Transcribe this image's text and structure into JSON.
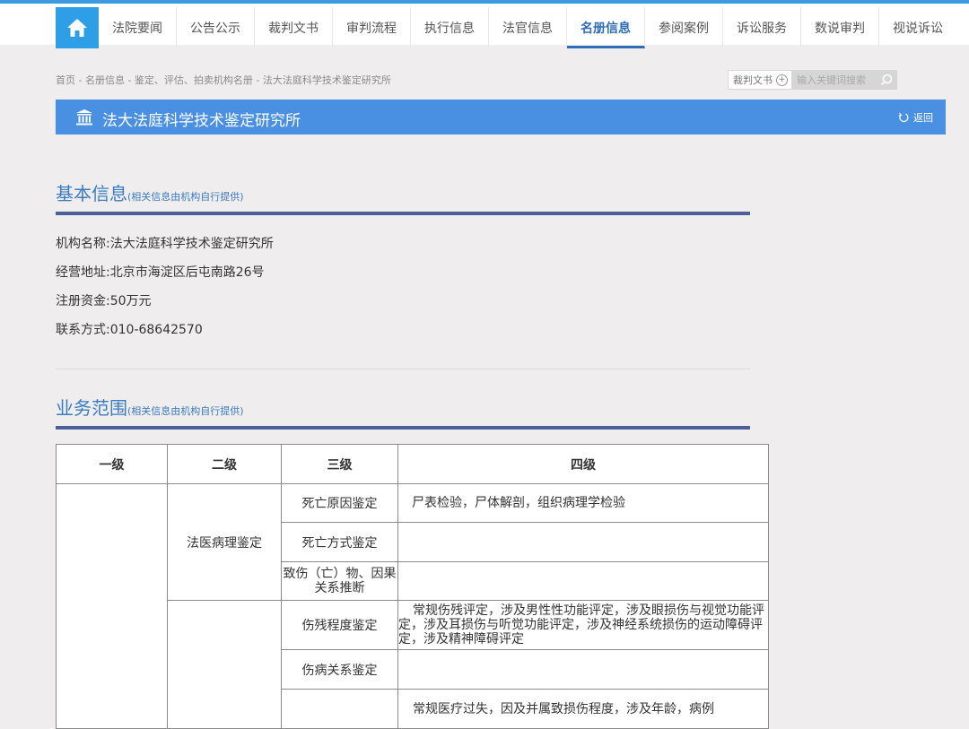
{
  "nav": {
    "home_icon": "home-icon",
    "items": [
      "法院要闻",
      "公告公示",
      "裁判文书",
      "审判流程",
      "执行信息",
      "法官信息",
      "名册信息",
      "参阅案例",
      "诉讼服务",
      "数说审判",
      "视说诉讼"
    ],
    "active_index": 6
  },
  "breadcrumb": "首页 - 名册信息 - 鉴定、评估、拍卖机构名册 - 法大法庭科学技术鉴定研究所",
  "search": {
    "scope": "裁判文书",
    "placeholder": "输入关键词搜索"
  },
  "titlebar": {
    "title": "法大法庭科学技术鉴定研究所",
    "back": "返回"
  },
  "basic": {
    "heading": "基本信息",
    "note": "(相关信息由机构自行提供)",
    "lines": [
      "机构名称:法大法庭科学技术鉴定研究所",
      "经营地址:北京市海淀区后屯南路26号",
      "注册资金:50万元",
      "联系方式:010-68642570"
    ]
  },
  "business": {
    "heading": "业务范围",
    "note": "(相关信息由机构自行提供)",
    "headers": [
      "一级",
      "二级",
      "三级",
      "四级"
    ],
    "rows": {
      "r1_l2": "法医病理鉴定",
      "r1_l3": "死亡原因鉴定",
      "r1_l4": "尸表检验，尸体解剖，组织病理学检验",
      "r2_l3": "死亡方式鉴定",
      "r3_l3": "致伤（亡）物、因果关系推断",
      "r4_l3": "伤残程度鉴定",
      "r4_l4": "常规伤残评定，涉及男性性功能评定，涉及眼损伤与视觉功能评定，涉及耳损伤与听觉功能评定，涉及神经系统损伤的运动障碍评定，涉及精神障碍评定",
      "r5_l3": "伤病关系鉴定",
      "r6_l4": "常规医疗过失，因及并属致损伤程度，涉及年龄，病例"
    }
  },
  "colors": {
    "nav_accent": "#2f6db5",
    "home_bg": "#2e9ee6",
    "titlebar_bg": "#4a90e2",
    "section_rule": "#4b5f9a"
  }
}
